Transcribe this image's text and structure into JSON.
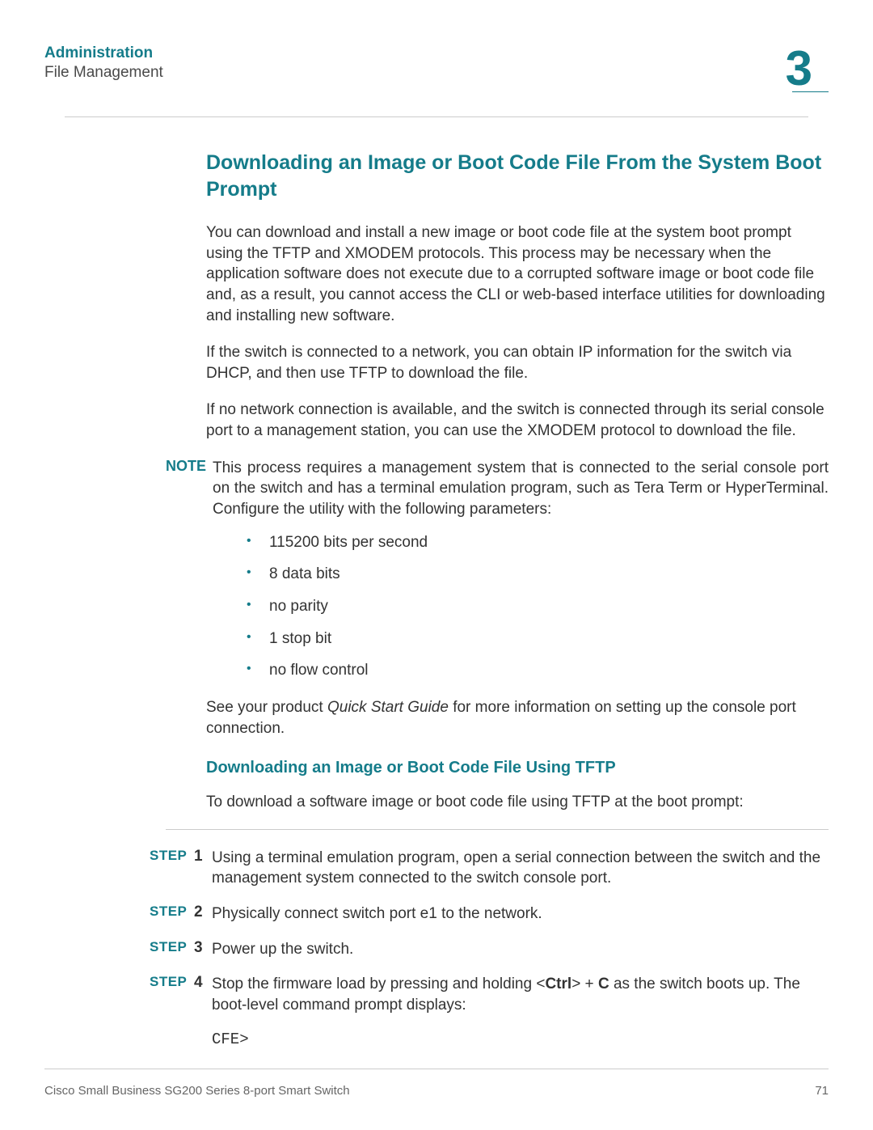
{
  "header": {
    "title": "Administration",
    "subtitle": "File Management",
    "chapter": "3"
  },
  "section": {
    "title": "Downloading an Image or Boot Code File From the System Boot Prompt",
    "p1": "You can download and install a new image or boot code file at the system boot prompt using the TFTP and XMODEM protocols. This process may be necessary when the application software does not execute due to a corrupted software image or boot code file and, as a result, you cannot access the CLI or web-based interface utilities for downloading and installing new software.",
    "p2": "If the switch is connected to a network, you can obtain IP information for the switch via DHCP, and then use TFTP to download the file.",
    "p3": "If no network connection is available, and the switch is connected through its serial console port to a management station, you can use the XMODEM protocol to download the file."
  },
  "note": {
    "label": "NOTE",
    "text": "This process requires a management system that is connected to the serial console port on the switch and has a terminal emulation program, such as Tera Term or HyperTerminal. Configure the utility with the following parameters:",
    "bullets": [
      "115200 bits per second",
      "8 data bits",
      "no parity",
      "1 stop bit",
      "no flow control"
    ],
    "after_pre": "See your product ",
    "after_em": "Quick Start Guide",
    "after_post": " for more information on setting up the console port connection."
  },
  "subsection": {
    "title": "Downloading an Image or Boot Code File Using TFTP",
    "intro": "To download a software image or boot code file using TFTP at the boot prompt:"
  },
  "steps": {
    "label": "STEP",
    "items": [
      {
        "num": "1",
        "text": "Using a terminal emulation program, open a serial connection between the switch and the management system connected to the switch console port."
      },
      {
        "num": "2",
        "text": "Physically connect switch port e1 to the network."
      },
      {
        "num": "3",
        "text": "Power up the switch."
      },
      {
        "num": "4",
        "pre": "Stop the firmware load by pressing and holding <",
        "b1": "Ctrl",
        "mid": "> + ",
        "b2": "C",
        "post": " as the switch boots up. The boot-level command prompt displays:"
      }
    ],
    "code": "CFE>"
  },
  "footer": {
    "left": "Cisco Small Business SG200 Series 8-port Smart Switch",
    "right": "71"
  }
}
